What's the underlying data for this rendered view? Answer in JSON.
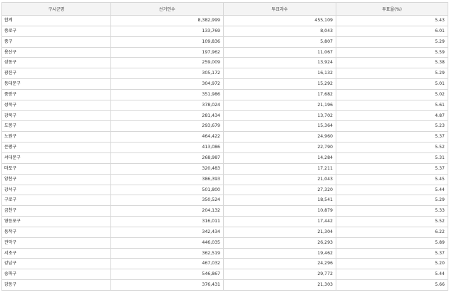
{
  "table": {
    "headers": [
      "구시군명",
      "선거인수",
      "투표자수",
      "투표율(%)"
    ],
    "rows": [
      [
        "합계",
        "8,382,999",
        "455,109",
        "5.43"
      ],
      [
        "종로구",
        "133,769",
        "8,043",
        "6.01"
      ],
      [
        "중구",
        "109,836",
        "5,807",
        "5.29"
      ],
      [
        "용산구",
        "197,962",
        "11,067",
        "5.59"
      ],
      [
        "성동구",
        "259,009",
        "13,924",
        "5.38"
      ],
      [
        "광진구",
        "305,172",
        "16,132",
        "5.29"
      ],
      [
        "동대문구",
        "304,972",
        "15,292",
        "5.01"
      ],
      [
        "중랑구",
        "351,986",
        "17,682",
        "5.02"
      ],
      [
        "성북구",
        "378,024",
        "21,196",
        "5.61"
      ],
      [
        "강북구",
        "281,434",
        "13,702",
        "4.87"
      ],
      [
        "도봉구",
        "293,679",
        "15,364",
        "5.23"
      ],
      [
        "노원구",
        "464,422",
        "24,960",
        "5.37"
      ],
      [
        "은평구",
        "413,086",
        "22,790",
        "5.52"
      ],
      [
        "서대문구",
        "268,987",
        "14,284",
        "5.31"
      ],
      [
        "마포구",
        "320,483",
        "17,211",
        "5.37"
      ],
      [
        "양천구",
        "386,393",
        "21,043",
        "5.45"
      ],
      [
        "강서구",
        "501,800",
        "27,320",
        "5.44"
      ],
      [
        "구로구",
        "350,524",
        "18,541",
        "5.29"
      ],
      [
        "금천구",
        "204,132",
        "10,879",
        "5.33"
      ],
      [
        "영등포구",
        "316,011",
        "17,442",
        "5.52"
      ],
      [
        "동작구",
        "342,434",
        "21,304",
        "6.22"
      ],
      [
        "관악구",
        "446,035",
        "26,293",
        "5.89"
      ],
      [
        "서초구",
        "362,519",
        "19,462",
        "5.37"
      ],
      [
        "강남구",
        "467,032",
        "24,296",
        "5.20"
      ],
      [
        "송파구",
        "546,867",
        "29,772",
        "5.44"
      ],
      [
        "강동구",
        "376,431",
        "21,303",
        "5.66"
      ]
    ]
  }
}
